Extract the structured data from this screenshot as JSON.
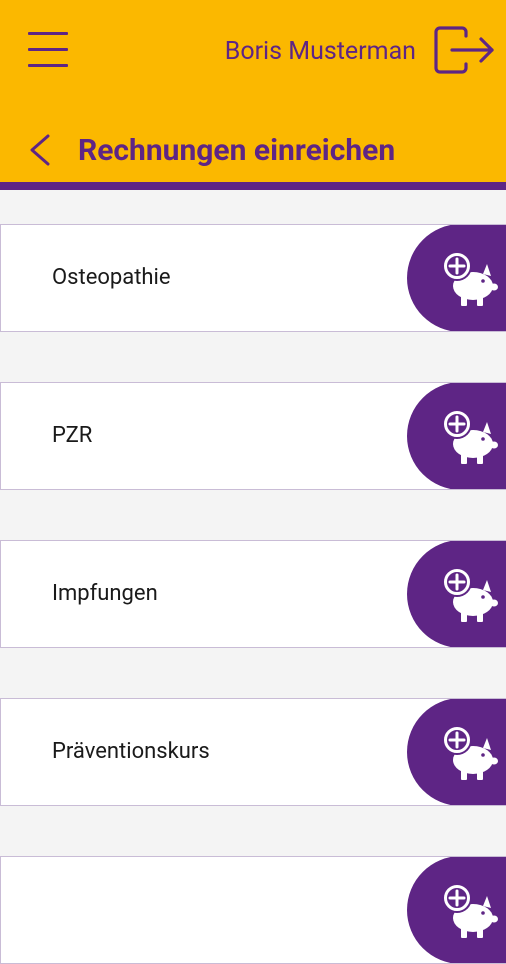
{
  "header": {
    "user_name": "Boris Musterman",
    "title": "Rechnungen einreichen",
    "icons": {
      "menu": "hamburger-menu-icon",
      "logout": "logout-icon",
      "back": "chevron-left-icon"
    }
  },
  "items": [
    {
      "label": "Osteopathie"
    },
    {
      "label": "PZR"
    },
    {
      "label": "Impfungen"
    },
    {
      "label": "Präventionskurs"
    },
    {
      "label": ""
    }
  ],
  "action_icon": "piggy-bank-add-icon",
  "colors": {
    "header_bg": "#fbb800",
    "accent": "#5e2585",
    "page_bg": "#f4f4f4",
    "card_bg": "#ffffff"
  }
}
